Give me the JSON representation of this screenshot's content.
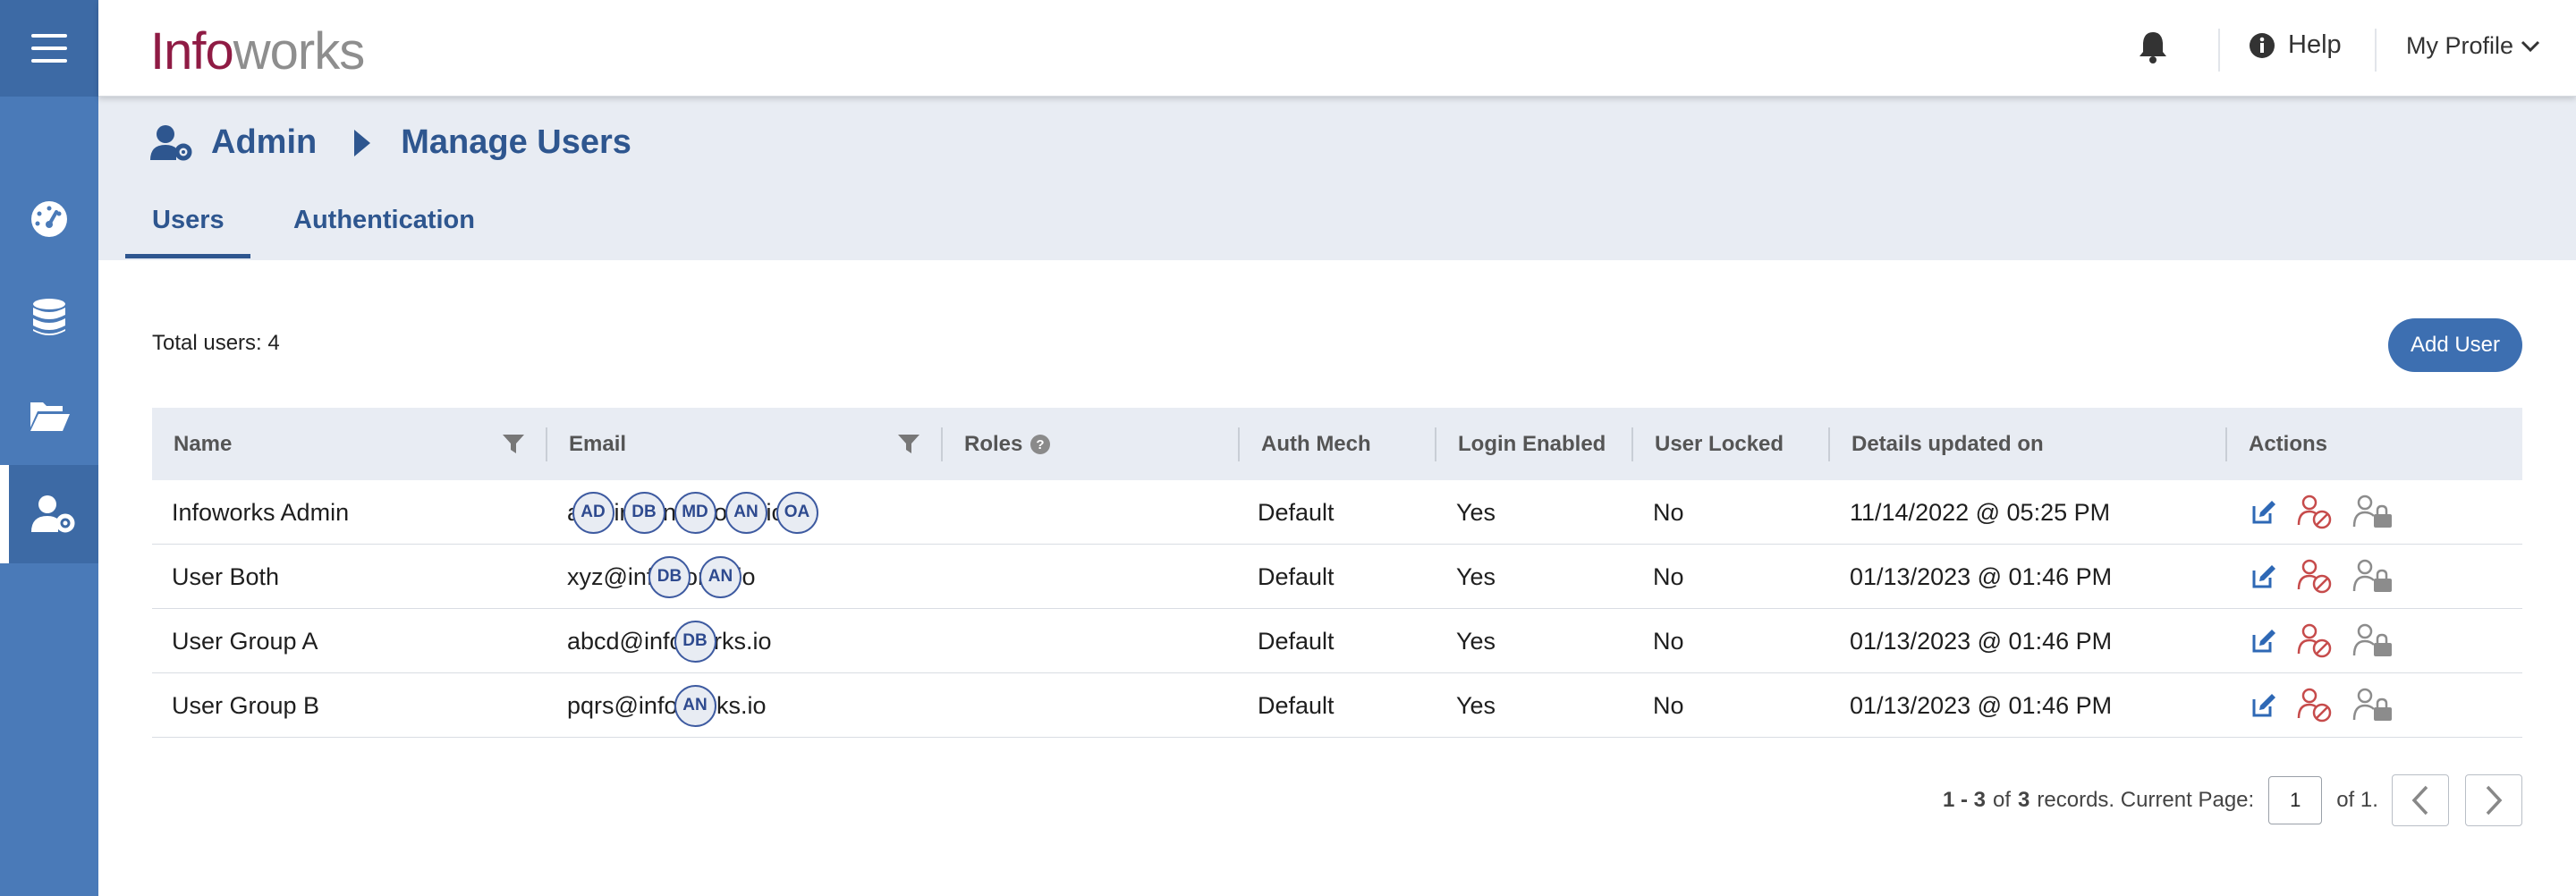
{
  "header": {
    "logo_part1": "Info",
    "logo_part2": "works",
    "help_label": "Help",
    "profile_label": "My Profile"
  },
  "breadcrumb": {
    "items": [
      "Admin",
      "Manage Users"
    ]
  },
  "tabs": [
    {
      "label": "Users",
      "active": true
    },
    {
      "label": "Authentication",
      "active": false
    }
  ],
  "sidebar": {
    "items": [
      "dashboard-icon",
      "database-icon",
      "folder-open-icon",
      "user-cog-icon"
    ],
    "active_index": 3
  },
  "summary": {
    "total_users": "Total users: 4"
  },
  "toolbar": {
    "add_user_label": "Add User"
  },
  "table": {
    "columns": [
      "Name",
      "Email",
      "Roles",
      "Auth Mech",
      "Login Enabled",
      "User Locked",
      "Details updated on",
      "Actions"
    ],
    "rows": [
      {
        "name": "Infoworks Admin",
        "email": "admin@infoworks.io",
        "roles": [
          "AD",
          "DB",
          "MD",
          "AN",
          "OA"
        ],
        "auth": "Default",
        "login": "Yes",
        "locked": "No",
        "updated": "11/14/2022 @ 05:25 PM"
      },
      {
        "name": "User Both",
        "email": "xyz@infoworks.io",
        "roles": [
          "DB",
          "AN"
        ],
        "auth": "Default",
        "login": "Yes",
        "locked": "No",
        "updated": "01/13/2023 @ 01:46 PM"
      },
      {
        "name": "User Group A",
        "email": "abcd@infoworks.io",
        "roles": [
          "DB"
        ],
        "auth": "Default",
        "login": "Yes",
        "locked": "No",
        "updated": "01/13/2023 @ 01:46 PM"
      },
      {
        "name": "User Group B",
        "email": "pqrs@infoworks.io",
        "roles": [
          "AN"
        ],
        "auth": "Default",
        "login": "Yes",
        "locked": "No",
        "updated": "01/13/2023 @ 01:46 PM"
      }
    ]
  },
  "pagination": {
    "range": "1 - 3",
    "of_word": "of",
    "total": "3",
    "records_text": "records. Current Page:",
    "current_page": "1",
    "of_pages": "of 1."
  },
  "colors": {
    "sidebar": "#4a7ab8",
    "accent": "#2e568f",
    "danger_icon": "#c64b4b",
    "brand_info": "#8f1b44",
    "brand_works": "#8e8e8e"
  }
}
